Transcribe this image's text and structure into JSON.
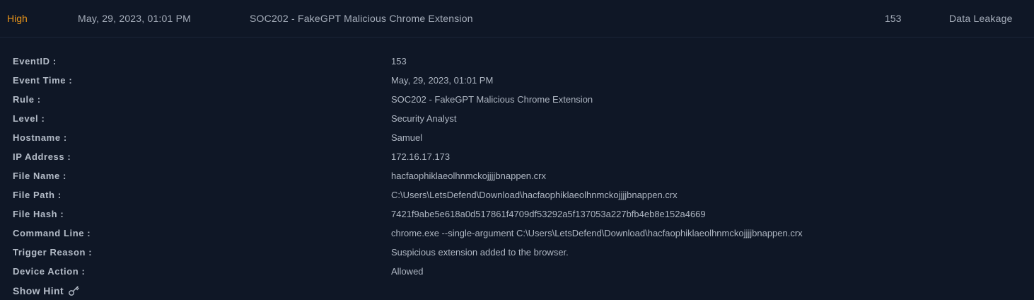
{
  "alert": {
    "level": "High",
    "time": "May, 29, 2023, 01:01 PM",
    "rule": "SOC202 - FakeGPT Malicious Chrome Extension",
    "event_id": "153",
    "type": "Data Leakage"
  },
  "details": [
    {
      "label": "EventID :",
      "value": "153"
    },
    {
      "label": "Event Time :",
      "value": "May, 29, 2023, 01:01 PM"
    },
    {
      "label": "Rule :",
      "value": "SOC202 - FakeGPT Malicious Chrome Extension"
    },
    {
      "label": "Level :",
      "value": "Security Analyst"
    },
    {
      "label": "Hostname :",
      "value": "Samuel"
    },
    {
      "label": "IP Address :",
      "value": "172.16.17.173"
    },
    {
      "label": "File Name :",
      "value": "hacfaophiklaeolhnmckojjjjbnappen.crx"
    },
    {
      "label": "File Path :",
      "value": "C:\\Users\\LetsDefend\\Download\\hacfaophiklaeolhnmckojjjjbnappen.crx"
    },
    {
      "label": "File Hash :",
      "value": "7421f9abe5e618a0d517861f4709df53292a5f137053a227bfb4eb8e152a4669"
    },
    {
      "label": "Command Line :",
      "value": "chrome.exe --single-argument C:\\Users\\LetsDefend\\Download\\hacfaophiklaeolhnmckojjjjbnappen.crx"
    },
    {
      "label": "Trigger Reason :",
      "value": "Suspicious extension added to the browser."
    },
    {
      "label": "Device Action :",
      "value": "Allowed"
    }
  ],
  "hint": {
    "label": "Show Hint",
    "icon": "key-icon"
  },
  "colors": {
    "background": "#0f1726",
    "level_high": "#e8941a",
    "text": "#aeb6c2"
  }
}
